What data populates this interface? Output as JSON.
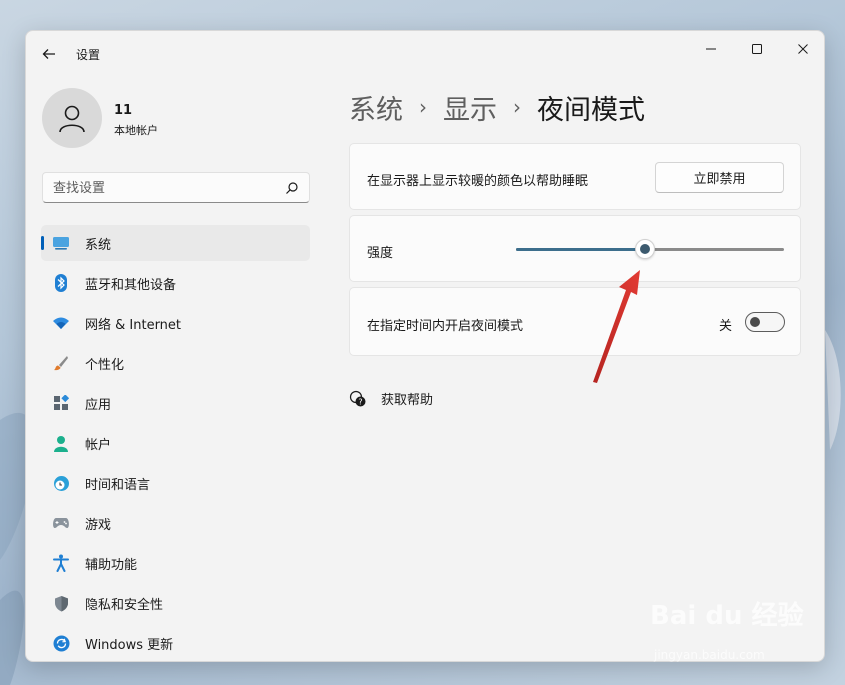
{
  "window": {
    "title": "设置"
  },
  "user": {
    "name": "11",
    "account_type": "本地帐户"
  },
  "search": {
    "placeholder": "查找设置"
  },
  "sidebar": {
    "items": [
      {
        "label": "系统",
        "icon": "monitor-icon"
      },
      {
        "label": "蓝牙和其他设备",
        "icon": "bluetooth-icon"
      },
      {
        "label": "网络 & Internet",
        "icon": "wifi-icon"
      },
      {
        "label": "个性化",
        "icon": "brush-icon"
      },
      {
        "label": "应用",
        "icon": "apps-icon"
      },
      {
        "label": "帐户",
        "icon": "person-icon"
      },
      {
        "label": "时间和语言",
        "icon": "globe-clock-icon"
      },
      {
        "label": "游戏",
        "icon": "gamepad-icon"
      },
      {
        "label": "辅助功能",
        "icon": "accessibility-icon"
      },
      {
        "label": "隐私和安全性",
        "icon": "shield-icon"
      },
      {
        "label": "Windows 更新",
        "icon": "update-icon"
      }
    ]
  },
  "breadcrumb": {
    "level1": "系统",
    "level2": "显示",
    "current": "夜间模式"
  },
  "night_light": {
    "description": "在显示器上显示较暖的颜色以帮助睡眠",
    "disable_button": "立即禁用",
    "strength_label": "强度",
    "strength_value": 0.48,
    "schedule_label": "在指定时间内开启夜间模式",
    "schedule_state": "关"
  },
  "help": {
    "label": "获取帮助"
  },
  "watermark": {
    "brand": "Bai du 经验",
    "url": "jingyan.baidu.com"
  },
  "colors": {
    "accent": "#005fb8",
    "slider_fill": "#3c6e8c",
    "annotation_arrow": "#d9322e"
  }
}
